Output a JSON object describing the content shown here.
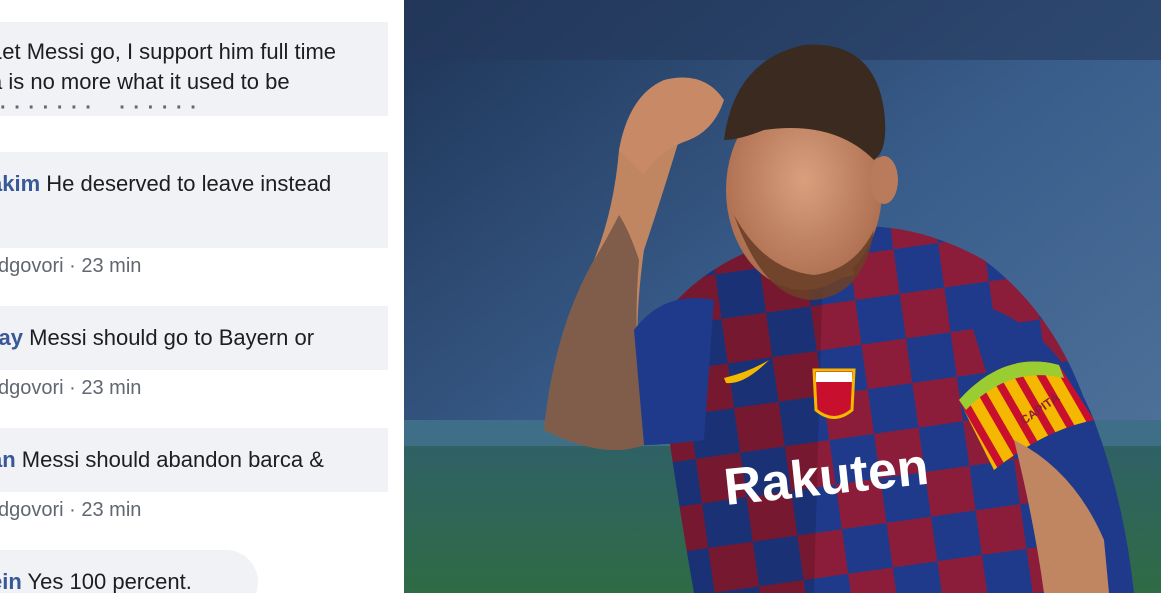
{
  "comments": [
    {
      "author": "",
      "line1": "Let Messi go, I support him full time",
      "line2": "a is no more what it used to be",
      "meta": ""
    },
    {
      "author": "akim",
      "text": " He deserved to leave instead",
      "meta": "dgovori · 23 min"
    },
    {
      "author": "ray",
      "text": " Messi should go to Bayern or",
      "meta": "dgovori · 23 min"
    },
    {
      "author": "an",
      "text": " Messi should abandon barca &",
      "meta": "dgovori · 23 min"
    },
    {
      "author": "ein",
      "text": " Yes 100 percent."
    }
  ],
  "photo": {
    "jersey_sponsor": "Rakuten",
    "armband_text": "CAPITÀ",
    "colors": {
      "stadium_blue": "#2f4f78",
      "grass_green": "#2f6b45",
      "jersey_blue": "#1f3a8a",
      "jersey_red": "#8c1d3a",
      "armband_yellow": "#f5b800",
      "armband_red": "#c8102e",
      "armband_green": "#9acd32"
    }
  }
}
